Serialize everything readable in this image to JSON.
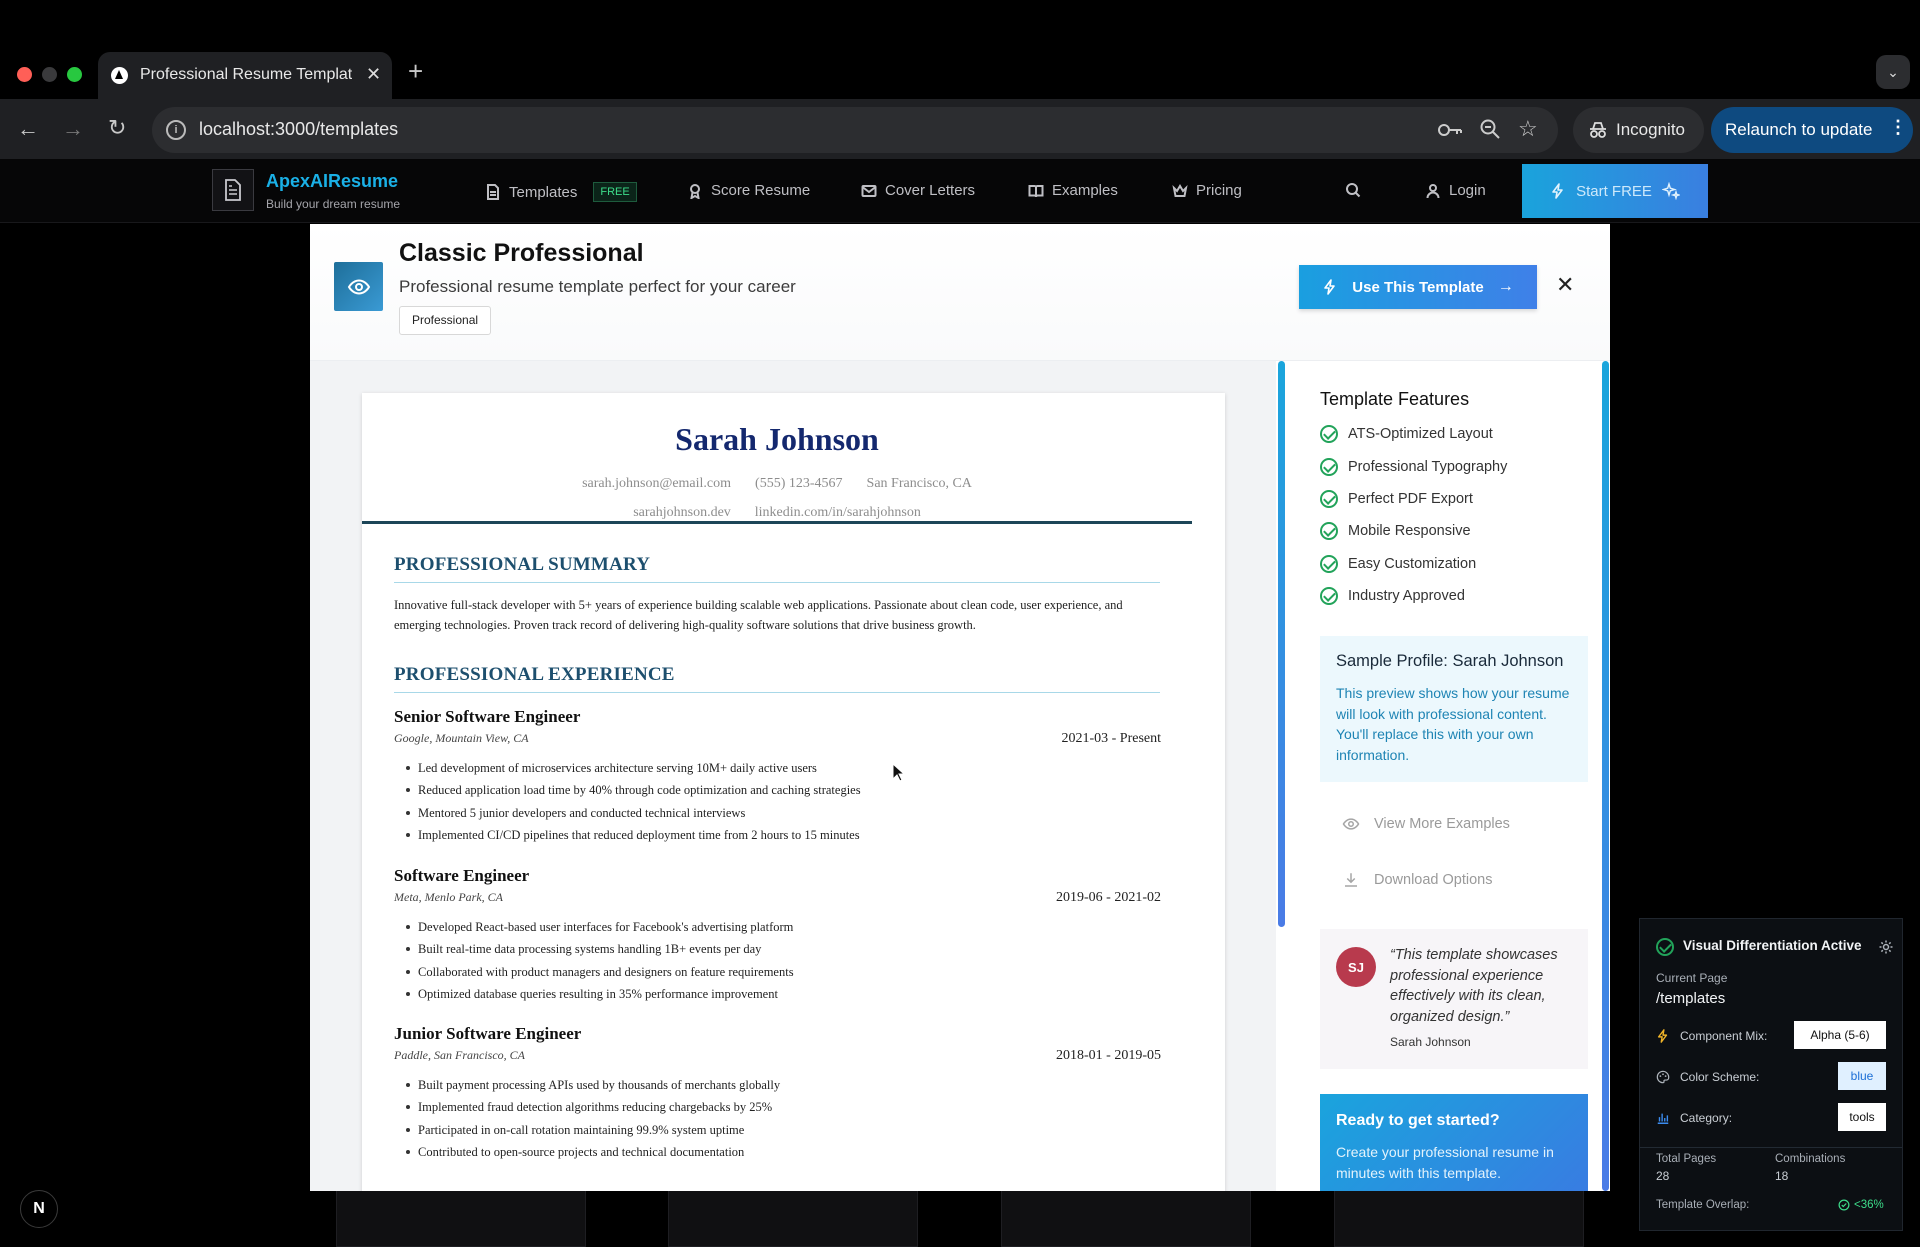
{
  "browser": {
    "tab_title": "Professional Resume Templat",
    "url": "localhost:3000/templates",
    "incognito_label": "Incognito",
    "relaunch_label": "Relaunch to update"
  },
  "nav": {
    "brand": "ApexAIResume",
    "tagline": "Build your dream resume",
    "items": [
      {
        "label": "Templates",
        "badge": "FREE",
        "icon": "document-icon"
      },
      {
        "label": "Score Resume",
        "icon": "award-icon"
      },
      {
        "label": "Cover Letters",
        "icon": "mail-icon"
      },
      {
        "label": "Examples",
        "icon": "book-icon"
      },
      {
        "label": "Pricing",
        "icon": "crown-icon"
      }
    ],
    "login": "Login",
    "cta": "Start FREE"
  },
  "modal": {
    "title": "Classic Professional",
    "subtitle": "Professional resume template perfect for your career",
    "tag": "Professional",
    "use_button": "Use This Template"
  },
  "resume": {
    "name": "Sarah Johnson",
    "email": "sarah.johnson@email.com",
    "phone": "(555) 123-4567",
    "location": "San Francisco, CA",
    "website": "sarahjohnson.dev",
    "linkedin": "linkedin.com/in/sarahjohnson",
    "summary_heading": "PROFESSIONAL SUMMARY",
    "summary": "Innovative full-stack developer with 5+ years of experience building scalable web applications. Passionate about clean code, user experience, and emerging technologies. Proven track record of delivering high-quality software solutions that drive business growth.",
    "experience_heading": "PROFESSIONAL EXPERIENCE",
    "jobs": [
      {
        "title": "Senior Software Engineer",
        "company": "Google, Mountain View, CA",
        "dates": "2021-03 - Present",
        "bullets": [
          "Led development of microservices architecture serving 10M+ daily active users",
          "Reduced application load time by 40% through code optimization and caching strategies",
          "Mentored 5 junior developers and conducted technical interviews",
          "Implemented CI/CD pipelines that reduced deployment time from 2 hours to 15 minutes"
        ]
      },
      {
        "title": "Software Engineer",
        "company": "Meta, Menlo Park, CA",
        "dates": "2019-06 - 2021-02",
        "bullets": [
          "Developed React-based user interfaces for Facebook's advertising platform",
          "Built real-time data processing systems handling 1B+ events per day",
          "Collaborated with product managers and designers on feature requirements",
          "Optimized database queries resulting in 35% performance improvement"
        ]
      },
      {
        "title": "Junior Software Engineer",
        "company": "Paddle, San Francisco, CA",
        "dates": "2018-01 - 2019-05",
        "bullets": [
          "Built payment processing APIs used by thousands of merchants globally",
          "Implemented fraud detection algorithms reducing chargebacks by 25%",
          "Participated in on-call rotation maintaining 99.9% system uptime",
          "Contributed to open-source projects and technical documentation"
        ]
      }
    ]
  },
  "sidebar": {
    "features_title": "Template Features",
    "features": [
      "ATS-Optimized Layout",
      "Professional Typography",
      "Perfect PDF Export",
      "Mobile Responsive",
      "Easy Customization",
      "Industry Approved"
    ],
    "sample_title": "Sample Profile: Sarah Johnson",
    "sample_text": "This preview shows how your resume will look with professional content. You'll replace this with your own information.",
    "view_more": "View More Examples",
    "download": "Download Options",
    "avatar_initials": "SJ",
    "quote": "“This template showcases professional experience effectively with its clean, organized design.”",
    "quote_author": "Sarah Johnson",
    "ready_title": "Ready to get started?",
    "ready_text": "Create your professional resume in minutes with this template."
  },
  "vd_panel": {
    "title": "Visual Differentiation Active",
    "current_page_label": "Current Page",
    "current_page": "/templates",
    "component_mix_label": "Component Mix:",
    "component_mix": "Alpha (5-6)",
    "color_scheme_label": "Color Scheme:",
    "color_scheme": "blue",
    "category_label": "Category:",
    "category": "tools",
    "total_pages_label": "Total Pages",
    "total_pages": "28",
    "combinations_label": "Combinations",
    "combinations": "18",
    "overlap_label": "Template Overlap:",
    "overlap": "<36%"
  },
  "next_badge": "N",
  "colors": {
    "accent": "#1aa3dc",
    "brand_text": "#1ab0e6",
    "resume_name": "#14286e",
    "success": "#22a35a"
  }
}
